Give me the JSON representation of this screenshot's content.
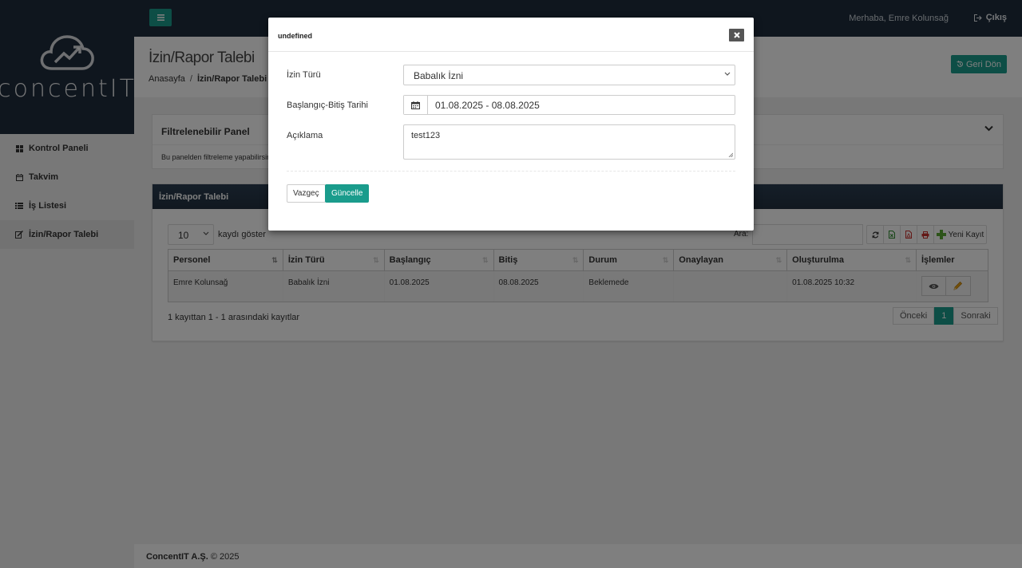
{
  "brand": {
    "logo_text": "concentIT"
  },
  "sidebar": {
    "items": [
      {
        "label": "Kontrol Paneli",
        "icon": "dashboard-icon"
      },
      {
        "label": "Takvim",
        "icon": "calendar-icon"
      },
      {
        "label": "İş Listesi",
        "icon": "list-icon"
      },
      {
        "label": "İzin/Rapor Talebi",
        "icon": "edit-icon"
      }
    ]
  },
  "topbar": {
    "greeting": "Merhaba, Emre Kolunsağ",
    "logout_label": "Çıkış"
  },
  "page": {
    "title": "İzin/Rapor Talebi",
    "breadcrumb_home": "Anasayfa",
    "breadcrumb_current": "İzin/Rapor Talebi",
    "back_label": "Geri Dön"
  },
  "filter_panel": {
    "title": "Filtrelenebilir Panel",
    "body": "Bu panelden filtreleme yapabilirsiniz."
  },
  "table_panel": {
    "title": "İzin/Rapor Talebi",
    "page_length": "10",
    "page_length_label": "kaydı göster",
    "search_label": "Ara:",
    "new_record_label": "Yeni Kayıt",
    "columns": [
      "Personel",
      "İzin Türü",
      "Başlangıç",
      "Bitiş",
      "Durum",
      "Onaylayan",
      "Oluşturulma",
      "İşlemler"
    ],
    "rows": [
      [
        "Emre Kolunsağ",
        "Babalık İzni",
        "01.08.2025",
        "08.08.2025",
        "Beklemede",
        "",
        "01.08.2025 10:32"
      ]
    ],
    "info": "1 kayıttan 1 - 1 arasındaki kayıtlar",
    "pager": {
      "prev": "Önceki",
      "current": "1",
      "next": "Sonraki"
    }
  },
  "footer": {
    "company": "ConcentIT A.Ş.",
    "copyright": "© 2025"
  },
  "modal": {
    "title": "undefined",
    "type_label": "İzin Türü",
    "type_value": "Babalık İzni",
    "date_label": "Başlangıç-Bitiş Tarihi",
    "date_value": "01.08.2025 - 08.08.2025",
    "desc_label": "Açıklama",
    "desc_value": "test123",
    "cancel_label": "Vazgeç",
    "update_label": "Güncelle"
  },
  "colors": {
    "accent": "#1a9c8c",
    "navbar": "#1f2d3d"
  }
}
